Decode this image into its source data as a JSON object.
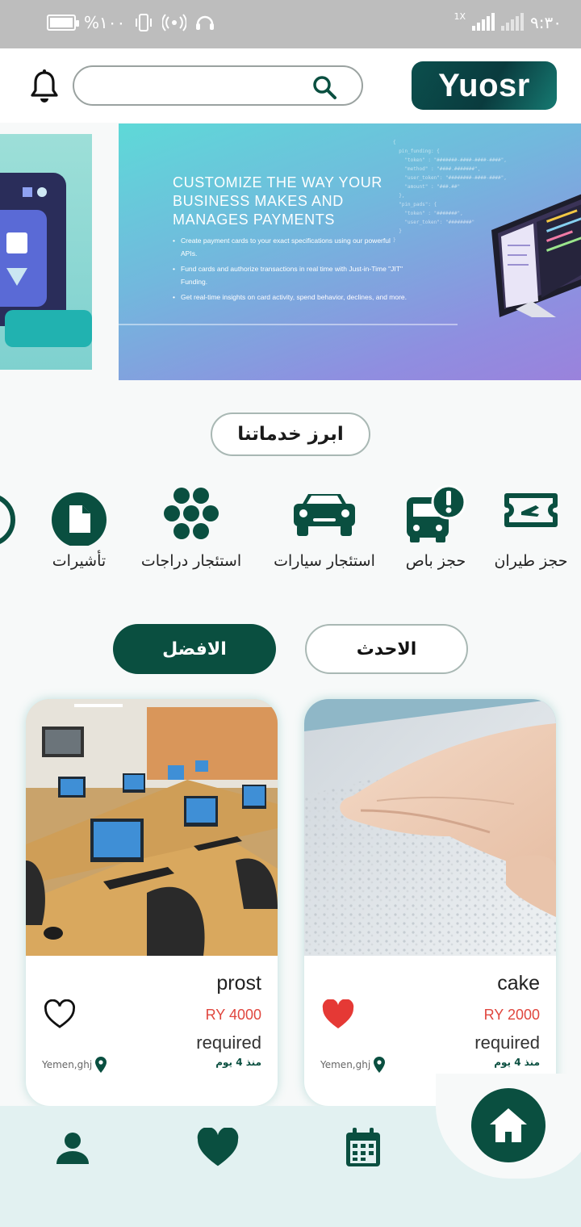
{
  "status_bar": {
    "battery_text": "%١٠٠",
    "time": "٩:٣٠",
    "speed_label": "1X"
  },
  "header": {
    "logo_text": "Yuosr",
    "search_placeholder": ""
  },
  "banner": {
    "headline": "CUSTOMIZE THE WAY YOUR BUSINESS MAKES AND MANAGES PAYMENTS",
    "bullets": [
      "Create payment cards to your exact specifications using our powerful APIs.",
      "Fund cards and authorize transactions in real time with Just-in-Time \"JIT\" Funding.",
      "Get real-time insights on card activity, spend behavior, declines, and more."
    ]
  },
  "section": {
    "title": "ابرز خدماتنا"
  },
  "services": [
    {
      "label": "حجز طيران",
      "icon": "plane-ticket-icon"
    },
    {
      "label": "حجز باص",
      "icon": "bus-alert-icon"
    },
    {
      "label": "استئجار سيارات",
      "icon": "car-icon"
    },
    {
      "label": "استئجار دراجات",
      "icon": "dots-flower-icon"
    },
    {
      "label": "تأشيرات",
      "icon": "document-icon"
    }
  ],
  "tabs": {
    "latest": "الاحدث",
    "best": "الافضل",
    "active": "best"
  },
  "products": [
    {
      "name": "cake",
      "price": "RY 2000",
      "status": "required",
      "time_ago": "منذ 4 يوم",
      "location": "Yemen,ghj",
      "favorited": true,
      "favorite_color": "#e53935"
    },
    {
      "name": "prost",
      "price": "RY 4000",
      "status": "required",
      "time_ago": "منذ 4 يوم",
      "location": "Yemen,ghj",
      "favorited": false
    }
  ],
  "colors": {
    "primary": "#0a4f40",
    "price": "#e0463e",
    "nav_bg": "#e2f1f1"
  },
  "bottom_nav": {
    "items": [
      "profile-icon",
      "favorites-icon",
      "calendar-icon",
      "home-icon"
    ],
    "active": "home"
  }
}
